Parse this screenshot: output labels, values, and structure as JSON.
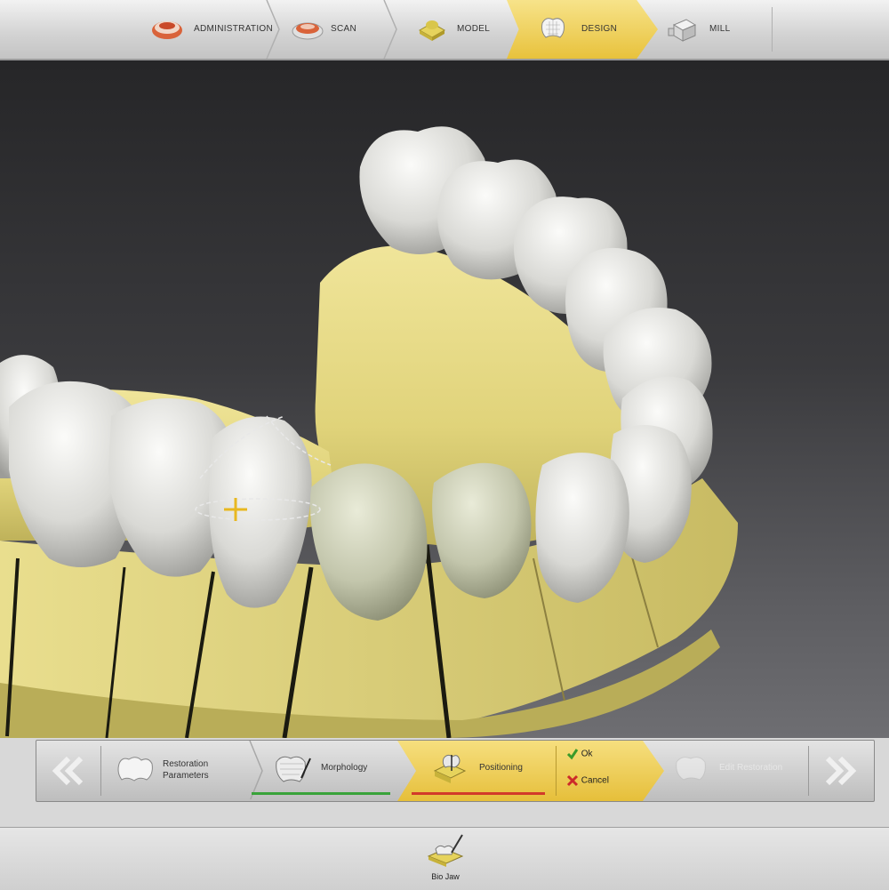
{
  "top_nav": {
    "phases": [
      {
        "label": "ADMINISTRATION",
        "icon": "jaw-impression-icon"
      },
      {
        "label": "SCAN",
        "icon": "scan-tray-icon"
      },
      {
        "label": "MODEL",
        "icon": "model-block-icon"
      },
      {
        "label": "DESIGN",
        "icon": "crown-design-icon"
      },
      {
        "label": "MILL",
        "icon": "milling-block-icon"
      }
    ],
    "active_phase": "DESIGN"
  },
  "workflow": {
    "back_icon": "double-chevron-left-icon",
    "forward_icon": "double-chevron-right-icon",
    "steps": [
      {
        "label_line1": "Restoration",
        "label_line2": "Parameters",
        "icon": "teeth-icon"
      },
      {
        "label": "Morphology",
        "icon": "crown-morphology-icon"
      },
      {
        "label": "Positioning",
        "icon": "positioning-icon"
      },
      {
        "label": "Edit Restoration",
        "icon": "edit-crown-icon"
      }
    ],
    "ok_label": "Ok",
    "cancel_label": "Cancel"
  },
  "bottom": {
    "bio_jaw_label": "Bio Jaw"
  },
  "colors": {
    "accent_gold": "#e8c23c",
    "model_yellow": "#e3d682",
    "tooth_white": "#e6e6e2",
    "restoration_green": "#c9ccb3",
    "ok_green": "#3a9a2a",
    "cancel_red": "#cc2a2a"
  }
}
